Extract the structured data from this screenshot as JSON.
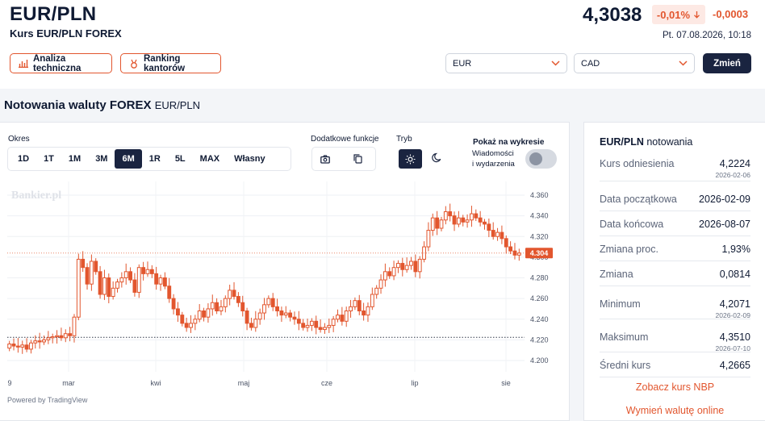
{
  "header": {
    "pair": "EUR/PLN",
    "subtitle": "Kurs EUR/PLN FOREX",
    "price": "4,3038",
    "change_pct": "-0,01%",
    "change_abs": "-0,0003",
    "datetime": "Pt. 07.08.2026, 10:18",
    "down_color": "#e2562e"
  },
  "actions": {
    "analysis": "Analiza techniczna",
    "ranking": "Ranking kantorów",
    "from_currency": "EUR",
    "to_currency": "CAD",
    "convert": "Zmień"
  },
  "section": {
    "title": "Notowania waluty FOREX",
    "pair": "EUR/PLN"
  },
  "controls": {
    "period_label": "Okres",
    "periods": [
      "1D",
      "1T",
      "1M",
      "3M",
      "6M",
      "1R",
      "5L",
      "MAX",
      "Własny"
    ],
    "active_period": "6M",
    "extra_label": "Dodatkowe funkcje",
    "mode_label": "Tryb",
    "show_label": "Pokaż na wykresie",
    "news_line1": "Wiadomości",
    "news_line2": "i wydarzenia",
    "news_on": false
  },
  "chart_data": {
    "type": "candlestick",
    "watermark": "Bankier.pl",
    "powered": "Powered by TradingView",
    "x_ticks": [
      "9",
      "mar",
      "kwi",
      "maj",
      "cze",
      "lip",
      "sie"
    ],
    "y_ticks": [
      "4.360",
      "4.340",
      "4.320",
      "4.300",
      "4.280",
      "4.260",
      "4.240",
      "4.220",
      "4.200"
    ],
    "ylim": [
      4.195,
      4.365
    ],
    "last_price_label": "4.304",
    "last_price": 4.304,
    "reference_line": 4.2224,
    "up_color": "#e2562e",
    "down_color": "#e2562e",
    "closes": [
      4.216,
      4.214,
      4.213,
      4.215,
      4.211,
      4.217,
      4.219,
      4.218,
      4.22,
      4.222,
      4.223,
      4.224,
      4.222,
      4.226,
      4.224,
      4.242,
      4.298,
      4.29,
      4.274,
      4.296,
      4.286,
      4.264,
      4.28,
      4.262,
      4.27,
      4.276,
      4.28,
      4.286,
      4.278,
      4.266,
      4.29,
      4.284,
      4.288,
      4.284,
      4.274,
      4.28,
      4.272,
      4.26,
      4.25,
      4.244,
      4.236,
      4.232,
      4.236,
      4.24,
      4.248,
      4.242,
      4.25,
      4.256,
      4.248,
      4.252,
      4.26,
      4.268,
      4.262,
      4.256,
      4.248,
      4.236,
      4.232,
      4.24,
      4.246,
      4.254,
      4.26,
      4.252,
      4.248,
      4.244,
      4.246,
      4.242,
      4.24,
      4.236,
      4.232,
      4.234,
      4.238,
      4.232,
      4.23,
      4.232,
      4.234,
      4.24,
      4.244,
      4.238,
      4.248,
      4.252,
      4.258,
      4.248,
      4.244,
      4.252,
      4.264,
      4.27,
      4.278,
      4.286,
      4.282,
      4.29,
      4.294,
      4.288,
      4.292,
      4.296,
      4.286,
      4.298,
      4.31,
      4.326,
      4.338,
      4.328,
      4.336,
      4.344,
      4.34,
      4.332,
      4.338,
      4.334,
      4.336,
      4.342,
      4.338,
      4.334,
      4.332,
      4.326,
      4.32,
      4.324,
      4.318,
      4.31,
      4.306,
      4.302,
      4.304
    ]
  },
  "stats": {
    "title_pair": "EUR/PLN",
    "title_suffix": "notowania",
    "rows": [
      {
        "label": "Kurs odniesienia",
        "value": "4,2224",
        "date": "2026-02-06"
      },
      {
        "label": "Data początkowa",
        "value": "2026-02-09",
        "date": ""
      },
      {
        "label": "Data końcowa",
        "value": "2026-08-07",
        "date": ""
      },
      {
        "label": "Zmiana proc.",
        "value": "1,93%",
        "date": ""
      },
      {
        "label": "Zmiana",
        "value": "0,0814",
        "date": ""
      },
      {
        "label": "Minimum",
        "value": "4,2071",
        "date": "2026-02-09"
      },
      {
        "label": "Maksimum",
        "value": "4,3510",
        "date": "2026-07-10"
      },
      {
        "label": "Średni kurs",
        "value": "4,2665",
        "date": ""
      }
    ],
    "link_nbp": "Zobacz kurs NBP",
    "link_exchange": "Wymień walutę online"
  }
}
